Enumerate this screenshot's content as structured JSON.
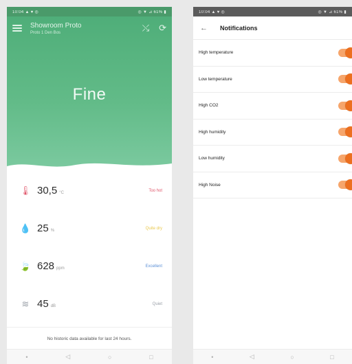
{
  "left_screen": {
    "statusbar": {
      "left": "10:04 ▲ ♥ ◎",
      "right": "◎ ▼ ⊿ 61% ▮"
    },
    "appbar": {
      "title": "Showroom Proto",
      "subtitle": "Proto 1 Den Bos"
    },
    "status_word": "Fine",
    "metrics": [
      {
        "icon": "thermometer-icon",
        "glyph": "🌡",
        "value": "30,5",
        "unit": "°C",
        "status": "Too hot",
        "color": "#e0566b"
      },
      {
        "icon": "humidity-icon",
        "glyph": "💧",
        "value": "25",
        "unit": "%",
        "status": "Quite dry",
        "color": "#e9c74a"
      },
      {
        "icon": "leaf-icon",
        "glyph": "🍃",
        "value": "628",
        "unit": "ppm",
        "status": "Excellent",
        "color": "#5b8fd6"
      },
      {
        "icon": "noise-icon",
        "glyph": "≋",
        "value": "45",
        "unit": "dB",
        "status": "Quiet",
        "color": "#9aa0a8"
      }
    ],
    "footer_note": "No historic data available for last 24 hours."
  },
  "right_screen": {
    "statusbar": {
      "left": "10:04 ▲ ♥ ◎",
      "right": "◎ ▼ ⊿ 61% ▮"
    },
    "title": "Notifications",
    "settings": [
      {
        "label": "High temperature",
        "enabled": true
      },
      {
        "label": "Low temperature",
        "enabled": true
      },
      {
        "label": "High CO2",
        "enabled": true
      },
      {
        "label": "High humidity",
        "enabled": true
      },
      {
        "label": "Low humidity",
        "enabled": true
      },
      {
        "label": "High Noise",
        "enabled": true
      }
    ]
  },
  "navbar": {
    "dot": "•",
    "back": "◁",
    "home": "○",
    "recent": "□"
  },
  "colors": {
    "accent_green": "#5db583",
    "toggle_orange": "#ec6f1f"
  }
}
